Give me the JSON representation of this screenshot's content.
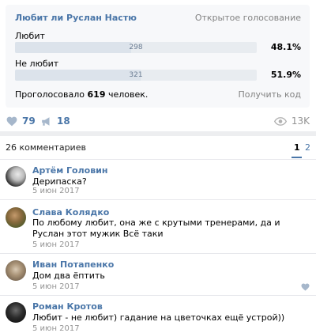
{
  "poll": {
    "title": "Любит ли Руслан Настю",
    "type": "Открытое голосование",
    "answers": [
      {
        "label": "Любит",
        "count": "298",
        "percent": "48.1%",
        "fraction": 0.481
      },
      {
        "label": "Не любит",
        "count": "321",
        "percent": "51.9%",
        "fraction": 0.519
      }
    ],
    "total_prefix": "Проголосовало",
    "total_count": "619",
    "total_suffix": "человек.",
    "get_code": "Получить код"
  },
  "actions": {
    "likes": "79",
    "shares": "18",
    "views": "13K"
  },
  "comments_header": {
    "count_label": "26 комментариев",
    "pages": [
      "1",
      "2"
    ]
  },
  "comments": [
    {
      "author": "Артём Головин",
      "text": "Дерипаска?",
      "date": "5 июн 2017"
    },
    {
      "author": "Слава Колядко",
      "text": "По любому любит, она же с крутыми тренерами, да и Руслан этот мужик Всё таки",
      "date": "5 июн 2017"
    },
    {
      "author": "Иван Потапенко",
      "text": "Дом два ёптить",
      "date": "5 июн 2017"
    },
    {
      "author": "Роман Кротов",
      "text": "Любит - не любит) гадание на цветочках ещё устрой))",
      "date": "5 июн 2017"
    }
  ],
  "colors": {
    "accent": "#4a76a8",
    "muted": "#939393",
    "bar_bg": "#e8ecf0",
    "bar_fill": "#dce3eb"
  }
}
